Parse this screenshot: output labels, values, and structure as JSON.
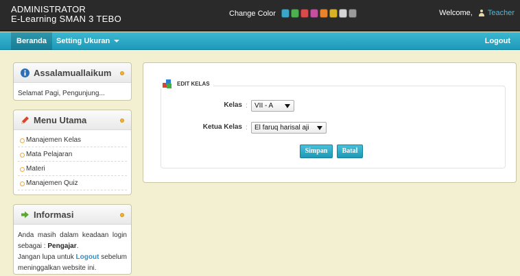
{
  "header": {
    "role": "ADMINISTRATOR",
    "site_name": "E-Learning SMAN 3 TEBO",
    "change_color_label": "Change Color",
    "color_swatches": [
      "#3aa6c9",
      "#4caf50",
      "#d94b4b",
      "#c74fa0",
      "#e8822d",
      "#d8b326",
      "#d6d6d6",
      "#9a9a9a"
    ],
    "welcome_label": "Welcome,",
    "user_name": "Teacher"
  },
  "nav": {
    "home": "Beranda",
    "settings": "Setting Ukuran",
    "logout": "Logout"
  },
  "sidebar": {
    "greeting": {
      "title": "Assalamuallaikum",
      "text": "Selamat Pagi, Pengunjung..."
    },
    "menu": {
      "title": "Menu Utama",
      "items": [
        "Manajemen Kelas",
        "Mata Pelajaran",
        "Materi",
        "Manajemen Quiz"
      ]
    },
    "info": {
      "title": "Informasi",
      "line1": "Anda masih dalam keadaan login sebagai :",
      "role": "Pengajar",
      "line2": "Jangan lupa untuk",
      "logout_word": "Logout",
      "line3": "sebelum meninggalkan website ini."
    }
  },
  "form": {
    "legend": "EDIT KELAS",
    "kelas_label": "Kelas",
    "kelas_value": "VII - A",
    "ketua_label": "Ketua Kelas",
    "ketua_value": "El faruq harisal aji",
    "separator": ":",
    "save_label": "Simpan",
    "cancel_label": "Batal"
  }
}
